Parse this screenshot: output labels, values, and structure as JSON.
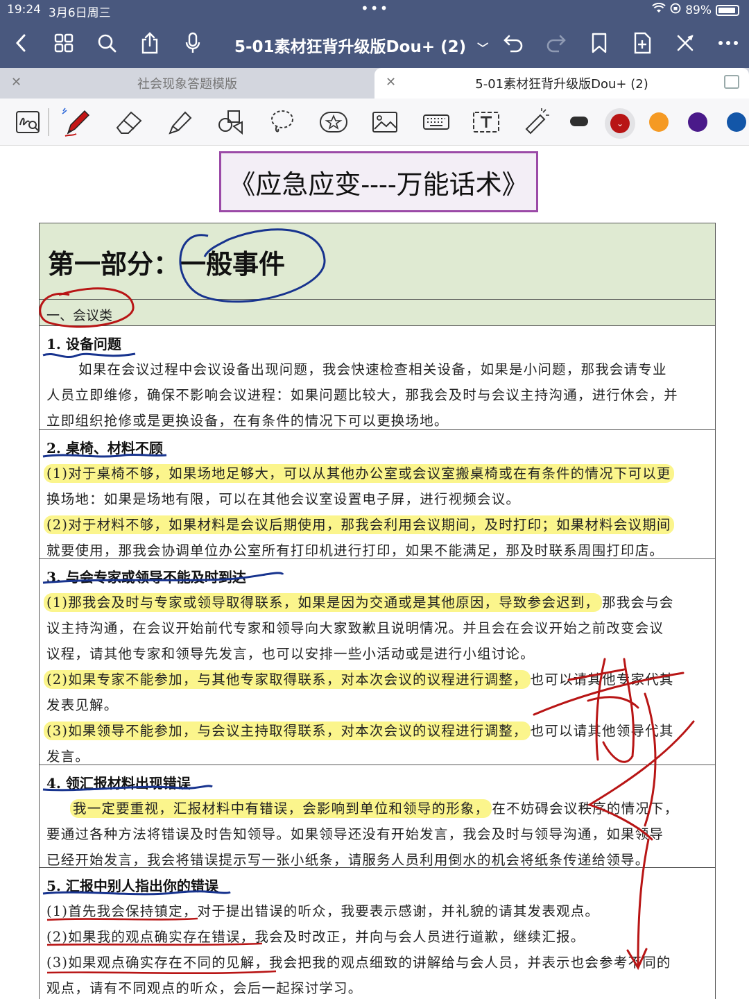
{
  "status_bar": {
    "time": "19:24",
    "date": "3月6日周三",
    "dots": "•••",
    "battery": "89%"
  },
  "nav": {
    "doc_title": "5-01素材狂背升级版Dou+ (2)",
    "dropdown": "⌄"
  },
  "tabs": [
    {
      "label": "社会现象答题模版",
      "active": false
    },
    {
      "label": "5-01素材狂背升级版Dou+ (2)",
      "active": true
    }
  ],
  "toolbar": {
    "tools": [
      "ink-to-text",
      "pen",
      "eraser",
      "highlighter",
      "shapes",
      "lasso",
      "sticker",
      "image",
      "keyboard",
      "text",
      "laser-pointer"
    ],
    "colors": [
      "#2f2f2f",
      "#b81515",
      "#f59a24",
      "#4a1a8a",
      "#1356a8"
    ],
    "selected_color": "#b81515"
  },
  "document": {
    "title": "《应急应变----万能话术》",
    "part": "第一部分：一般事件",
    "category": "一、会议类",
    "sections": [
      {
        "head": "1. 设备问题",
        "lines": [
          "如果在会议过程中会议设备出现问题，我会快速检查相关设备，如果是小问题，那我会请专业",
          "人员立即维修，确保不影响会议进程：如果问题比较大，那我会及时与会议主持沟通，进行休会，并",
          "立即组织抢修或是更换设备，在有条件的情况下可以更换场地。"
        ]
      },
      {
        "head": "2. 桌椅、材料不顾",
        "lines": [
          "(1)对于桌椅不够，如果场地足够大，可以从其他办公室或会议室搬桌椅或在有条件的情况下可以更",
          "换场地：如果是场地有限，可以在其他会议室设置电子屏，进行视频会议。",
          "(2)对于材料不够，如果材料是会议后期使用，那我会利用会议期间，及时打印；如果材料会议期间",
          "就要使用，那我会协调单位办公室所有打印机进行打印，如果不能满足，那及时联系周围打印店。"
        ]
      },
      {
        "head": "3. 与会专家或领导不能及时到达",
        "lines": [
          "(1)那我会及时与专家或领导取得联系，如果是因为交通或是其他原因，导致参会迟到，",
          "那我会与会",
          "议主持沟通，在会议开始前代专家和领导向大家致歉且说明情况。并且会在会议开始之前改变会议",
          "议程，请其他专家和领导先发言，也可以安排一些小活动或是进行小组讨论。",
          "(2)如果专家不能参加，与其他专家取得联系，对本次会议的议程进行调整，",
          "也可以请其他专家代其",
          "发表见解。",
          "(3)如果领导不能参加，与会议主持取得联系，对本次会议的议程进行调整，",
          "也可以请其他领导代其",
          "发言。"
        ]
      },
      {
        "head": "4. 领汇报材料出现错误",
        "lines": [
          "我一定要重视，汇报材料中有错误，会影响到单位和领导的形象，",
          "在不妨碍会议秩序的情况下，",
          "要通过各种方法将错误及时告知领导。如果领导还没有开始发言，我会及时与领导沟通，如果领导",
          "已经开始发言，我会将错误提示写一张小纸条，请服务人员利用倒水的机会将纸条传递给领导。"
        ]
      },
      {
        "head": "5. 汇报中别人指出你的错误",
        "lines": [
          "(1)首先我会保持镇定，对于提出错误的听众，我要表示感谢，并礼貌的请其发表观点。",
          "(2)如果我的观点确实存在错误，我会及时改正，并向与会人员进行道歉，继续汇报。",
          "(3)如果观点确实存在不同的见解，我会把我的观点细致的讲解给与会人员，并表示也会参考不同的",
          "观点，请有不同观点的听众，会后一起探讨学习。"
        ]
      }
    ]
  }
}
